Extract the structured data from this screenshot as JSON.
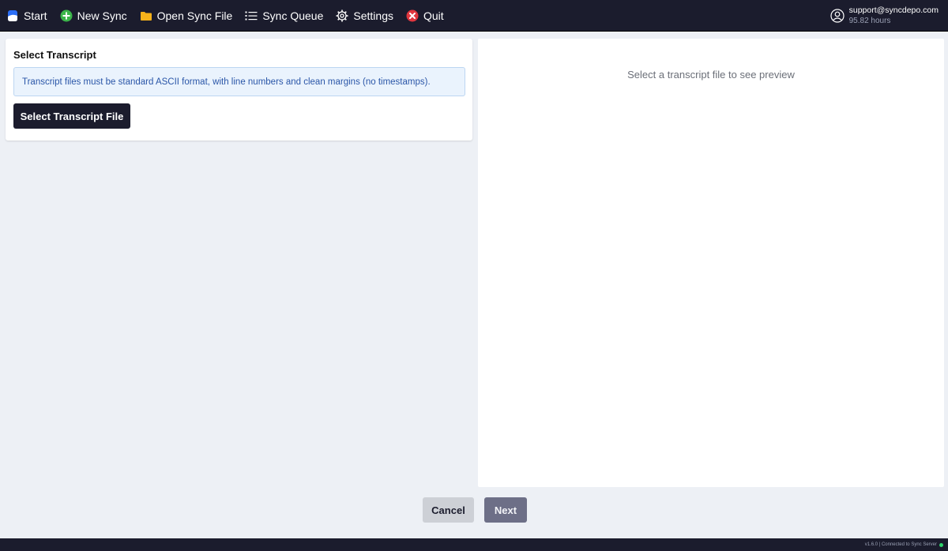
{
  "menu": {
    "items": [
      {
        "label": "Start",
        "icon": "logo-icon"
      },
      {
        "label": "New Sync",
        "icon": "plus-circle-icon"
      },
      {
        "label": "Open Sync File",
        "icon": "folder-icon"
      },
      {
        "label": "Sync Queue",
        "icon": "list-icon"
      },
      {
        "label": "Settings",
        "icon": "gear-icon"
      },
      {
        "label": "Quit",
        "icon": "close-circle-icon"
      }
    ]
  },
  "account": {
    "email": "support@syncdepo.com",
    "hours": "95.82 hours",
    "icon": "user-circle-icon"
  },
  "left": {
    "title": "Select Transcript",
    "info": "Transcript files must be standard ASCII format, with line numbers and clean margins (no timestamps).",
    "select_button": "Select Transcript File"
  },
  "preview": {
    "placeholder": "Select a transcript file to see preview"
  },
  "footer": {
    "cancel": "Cancel",
    "next": "Next"
  },
  "status": {
    "text": "v1.6.0 | Connected to Sync Server",
    "connected_color": "#2fd36b"
  },
  "colors": {
    "menubar": "#1b1c2d",
    "info_bg": "#eaf3fd",
    "info_text": "#2a56a8"
  }
}
